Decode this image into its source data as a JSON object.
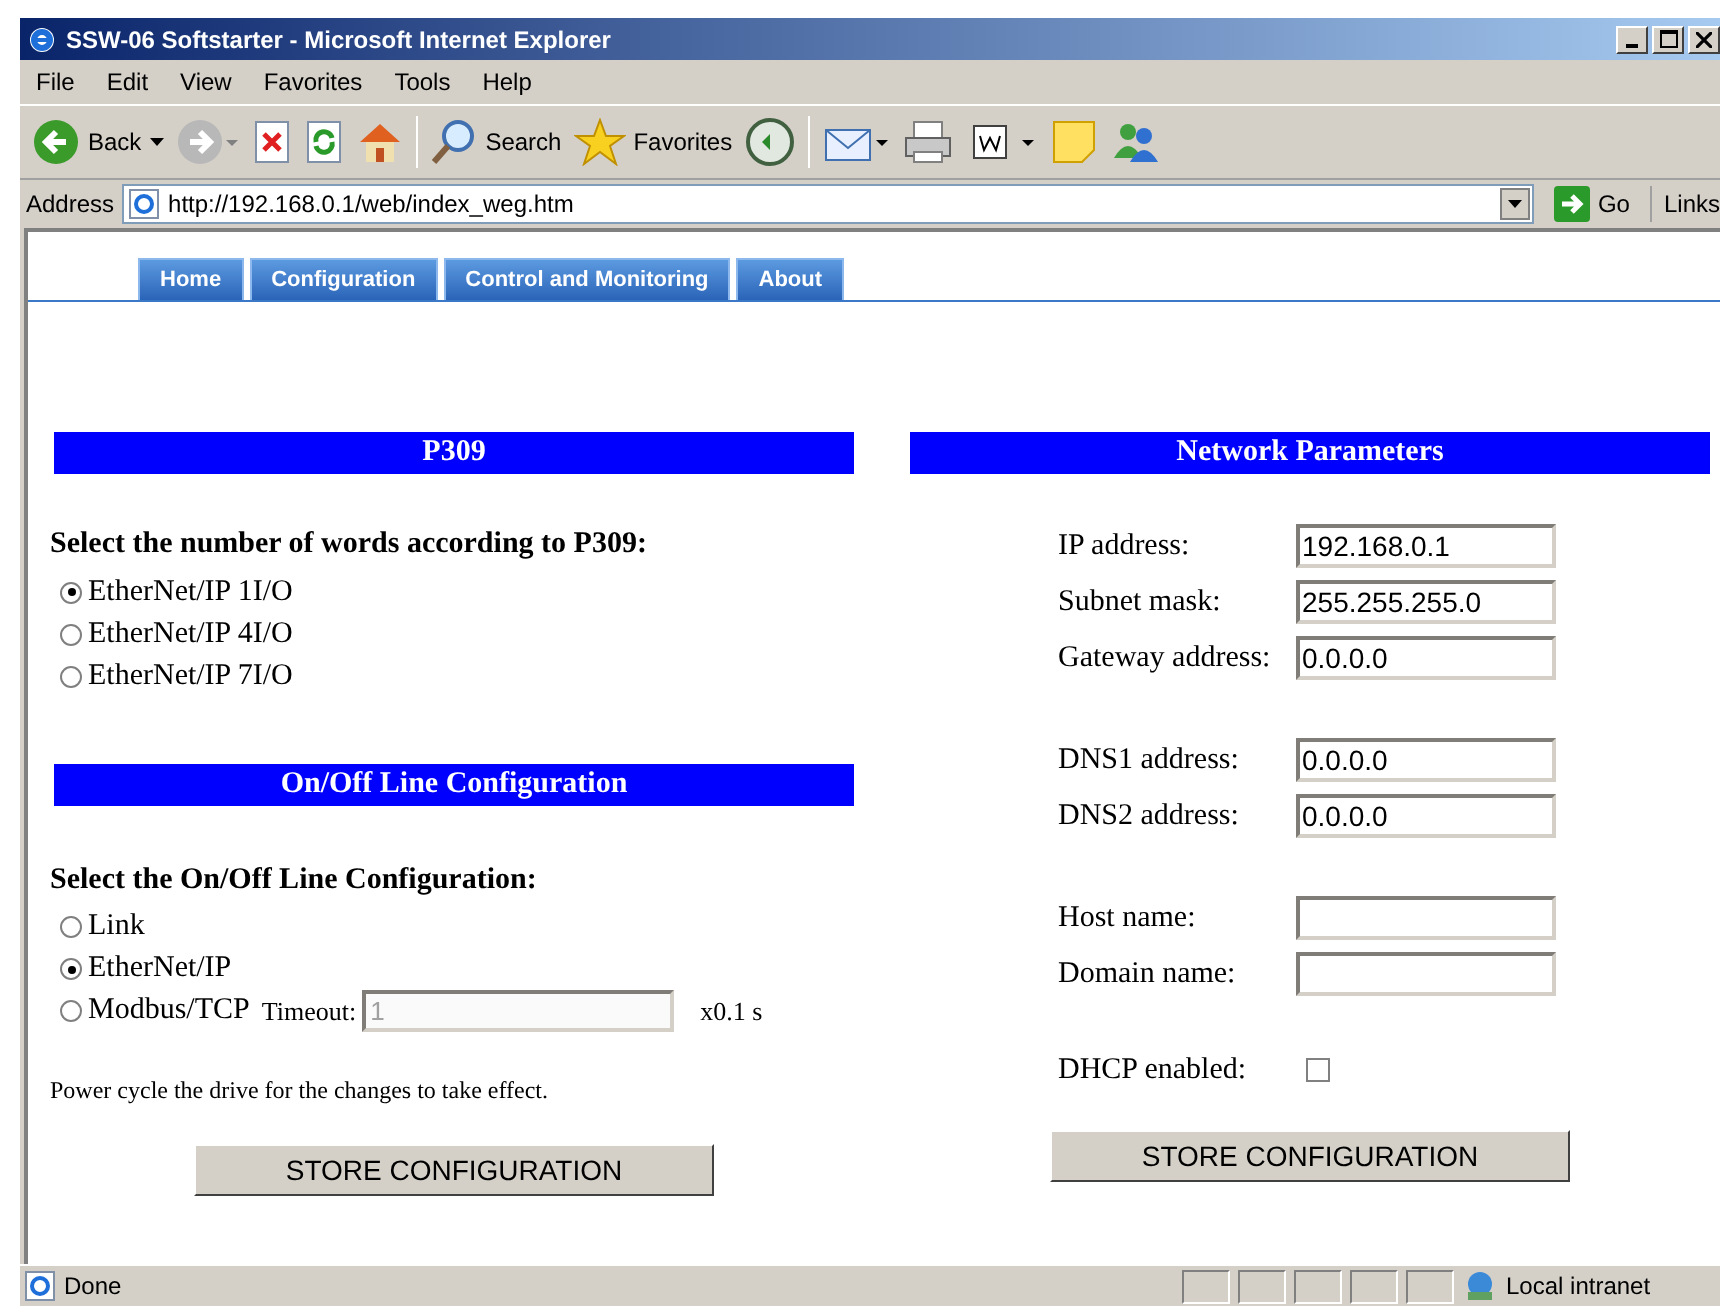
{
  "window": {
    "title": "SSW-06 Softstarter - Microsoft Internet Explorer"
  },
  "menu": [
    {
      "label": "File"
    },
    {
      "label": "Edit"
    },
    {
      "label": "View"
    },
    {
      "label": "Favorites"
    },
    {
      "label": "Tools"
    },
    {
      "label": "Help"
    }
  ],
  "toolbar": {
    "back": "Back",
    "search": "Search",
    "favorites": "Favorites"
  },
  "address_bar": {
    "label": "Address",
    "url": "http://192.168.0.1/web/index_weg.htm",
    "go": "Go",
    "links": "Links"
  },
  "nav_tabs": [
    {
      "label": "Home"
    },
    {
      "label": "Configuration"
    },
    {
      "label": "Control and Monitoring"
    },
    {
      "label": "About"
    }
  ],
  "p309": {
    "title": "P309",
    "prompt": "Select the number of words according to P309:",
    "options": [
      {
        "label": "EtherNet/IP 1I/O",
        "selected": true
      },
      {
        "label": "EtherNet/IP 4I/O",
        "selected": false
      },
      {
        "label": "EtherNet/IP 7I/O",
        "selected": false
      }
    ]
  },
  "online": {
    "title": "On/Off Line Configuration",
    "prompt": "Select the On/Off Line Configuration:",
    "options": [
      {
        "label": "Link",
        "selected": false
      },
      {
        "label": "EtherNet/IP",
        "selected": true
      },
      {
        "label": "Modbus/TCP",
        "selected": false
      }
    ],
    "timeout": {
      "label": "Timeout:",
      "value": "1",
      "disabled": true,
      "unit": "x0.1 s"
    },
    "note": "Power cycle the drive for the changes to take effect.",
    "button": "STORE CONFIGURATION"
  },
  "network": {
    "title": "Network Parameters",
    "groups": [
      [
        {
          "label": "IP address:",
          "value": "192.168.0.1"
        },
        {
          "label": "Subnet mask:",
          "value": "255.255.255.0"
        },
        {
          "label": "Gateway address:",
          "value": "0.0.0.0"
        }
      ],
      [
        {
          "label": "DNS1 address:",
          "value": "0.0.0.0"
        },
        {
          "label": "DNS2 address:",
          "value": "0.0.0.0"
        }
      ],
      [
        {
          "label": "Host name:"
        },
        {
          "label": "Domain name:"
        }
      ]
    ],
    "dhcp": {
      "label": "DHCP enabled:",
      "checked": false
    },
    "button": "STORE CONFIGURATION"
  },
  "status_bar": {
    "text": "Done",
    "zone": "Local intranet"
  }
}
